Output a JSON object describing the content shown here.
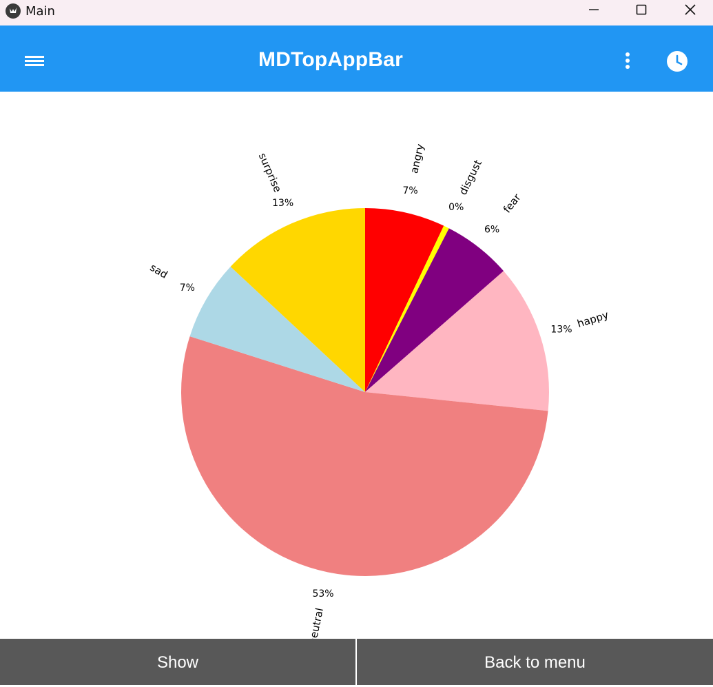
{
  "window": {
    "title": "Main"
  },
  "appbar": {
    "title": "MDTopAppBar"
  },
  "buttons": {
    "show": "Show",
    "back": "Back to menu"
  },
  "chart_data": {
    "type": "pie",
    "start_angle_deg": 90,
    "direction": "clockwise",
    "labels": [
      "angry",
      "disgust",
      "fear",
      "happy",
      "neutral",
      "sad",
      "surprise"
    ],
    "values": [
      7,
      0.5,
      6,
      13,
      53,
      7,
      13
    ],
    "pct_labels": [
      "7%",
      "0%",
      "6%",
      "13%",
      "53%",
      "7%",
      "13%"
    ],
    "colors": [
      "#ff0000",
      "#ffff00",
      "#800080",
      "#ffb6c1",
      "#f08080",
      "#add8e6",
      "#ffd700"
    ]
  }
}
